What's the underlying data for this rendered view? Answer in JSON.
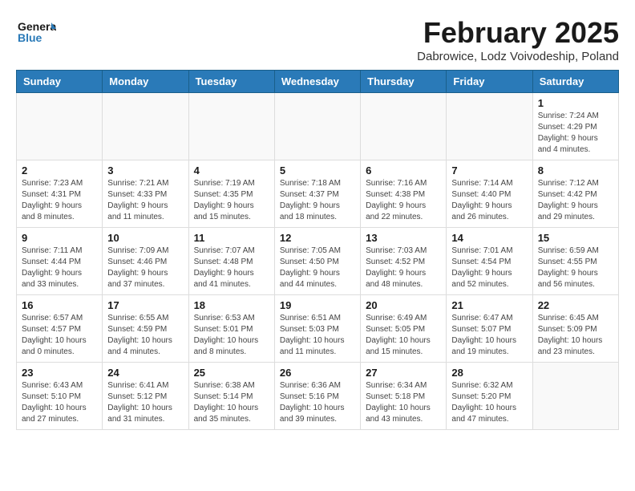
{
  "logo": {
    "line1": "General",
    "line2": "Blue"
  },
  "title": "February 2025",
  "subtitle": "Dabrowice, Lodz Voivodeship, Poland",
  "weekdays": [
    "Sunday",
    "Monday",
    "Tuesday",
    "Wednesday",
    "Thursday",
    "Friday",
    "Saturday"
  ],
  "weeks": [
    [
      {
        "day": "",
        "info": ""
      },
      {
        "day": "",
        "info": ""
      },
      {
        "day": "",
        "info": ""
      },
      {
        "day": "",
        "info": ""
      },
      {
        "day": "",
        "info": ""
      },
      {
        "day": "",
        "info": ""
      },
      {
        "day": "1",
        "info": "Sunrise: 7:24 AM\nSunset: 4:29 PM\nDaylight: 9 hours and 4 minutes."
      }
    ],
    [
      {
        "day": "2",
        "info": "Sunrise: 7:23 AM\nSunset: 4:31 PM\nDaylight: 9 hours and 8 minutes."
      },
      {
        "day": "3",
        "info": "Sunrise: 7:21 AM\nSunset: 4:33 PM\nDaylight: 9 hours and 11 minutes."
      },
      {
        "day": "4",
        "info": "Sunrise: 7:19 AM\nSunset: 4:35 PM\nDaylight: 9 hours and 15 minutes."
      },
      {
        "day": "5",
        "info": "Sunrise: 7:18 AM\nSunset: 4:37 PM\nDaylight: 9 hours and 18 minutes."
      },
      {
        "day": "6",
        "info": "Sunrise: 7:16 AM\nSunset: 4:38 PM\nDaylight: 9 hours and 22 minutes."
      },
      {
        "day": "7",
        "info": "Sunrise: 7:14 AM\nSunset: 4:40 PM\nDaylight: 9 hours and 26 minutes."
      },
      {
        "day": "8",
        "info": "Sunrise: 7:12 AM\nSunset: 4:42 PM\nDaylight: 9 hours and 29 minutes."
      }
    ],
    [
      {
        "day": "9",
        "info": "Sunrise: 7:11 AM\nSunset: 4:44 PM\nDaylight: 9 hours and 33 minutes."
      },
      {
        "day": "10",
        "info": "Sunrise: 7:09 AM\nSunset: 4:46 PM\nDaylight: 9 hours and 37 minutes."
      },
      {
        "day": "11",
        "info": "Sunrise: 7:07 AM\nSunset: 4:48 PM\nDaylight: 9 hours and 41 minutes."
      },
      {
        "day": "12",
        "info": "Sunrise: 7:05 AM\nSunset: 4:50 PM\nDaylight: 9 hours and 44 minutes."
      },
      {
        "day": "13",
        "info": "Sunrise: 7:03 AM\nSunset: 4:52 PM\nDaylight: 9 hours and 48 minutes."
      },
      {
        "day": "14",
        "info": "Sunrise: 7:01 AM\nSunset: 4:54 PM\nDaylight: 9 hours and 52 minutes."
      },
      {
        "day": "15",
        "info": "Sunrise: 6:59 AM\nSunset: 4:55 PM\nDaylight: 9 hours and 56 minutes."
      }
    ],
    [
      {
        "day": "16",
        "info": "Sunrise: 6:57 AM\nSunset: 4:57 PM\nDaylight: 10 hours and 0 minutes."
      },
      {
        "day": "17",
        "info": "Sunrise: 6:55 AM\nSunset: 4:59 PM\nDaylight: 10 hours and 4 minutes."
      },
      {
        "day": "18",
        "info": "Sunrise: 6:53 AM\nSunset: 5:01 PM\nDaylight: 10 hours and 8 minutes."
      },
      {
        "day": "19",
        "info": "Sunrise: 6:51 AM\nSunset: 5:03 PM\nDaylight: 10 hours and 11 minutes."
      },
      {
        "day": "20",
        "info": "Sunrise: 6:49 AM\nSunset: 5:05 PM\nDaylight: 10 hours and 15 minutes."
      },
      {
        "day": "21",
        "info": "Sunrise: 6:47 AM\nSunset: 5:07 PM\nDaylight: 10 hours and 19 minutes."
      },
      {
        "day": "22",
        "info": "Sunrise: 6:45 AM\nSunset: 5:09 PM\nDaylight: 10 hours and 23 minutes."
      }
    ],
    [
      {
        "day": "23",
        "info": "Sunrise: 6:43 AM\nSunset: 5:10 PM\nDaylight: 10 hours and 27 minutes."
      },
      {
        "day": "24",
        "info": "Sunrise: 6:41 AM\nSunset: 5:12 PM\nDaylight: 10 hours and 31 minutes."
      },
      {
        "day": "25",
        "info": "Sunrise: 6:38 AM\nSunset: 5:14 PM\nDaylight: 10 hours and 35 minutes."
      },
      {
        "day": "26",
        "info": "Sunrise: 6:36 AM\nSunset: 5:16 PM\nDaylight: 10 hours and 39 minutes."
      },
      {
        "day": "27",
        "info": "Sunrise: 6:34 AM\nSunset: 5:18 PM\nDaylight: 10 hours and 43 minutes."
      },
      {
        "day": "28",
        "info": "Sunrise: 6:32 AM\nSunset: 5:20 PM\nDaylight: 10 hours and 47 minutes."
      },
      {
        "day": "",
        "info": ""
      }
    ]
  ]
}
